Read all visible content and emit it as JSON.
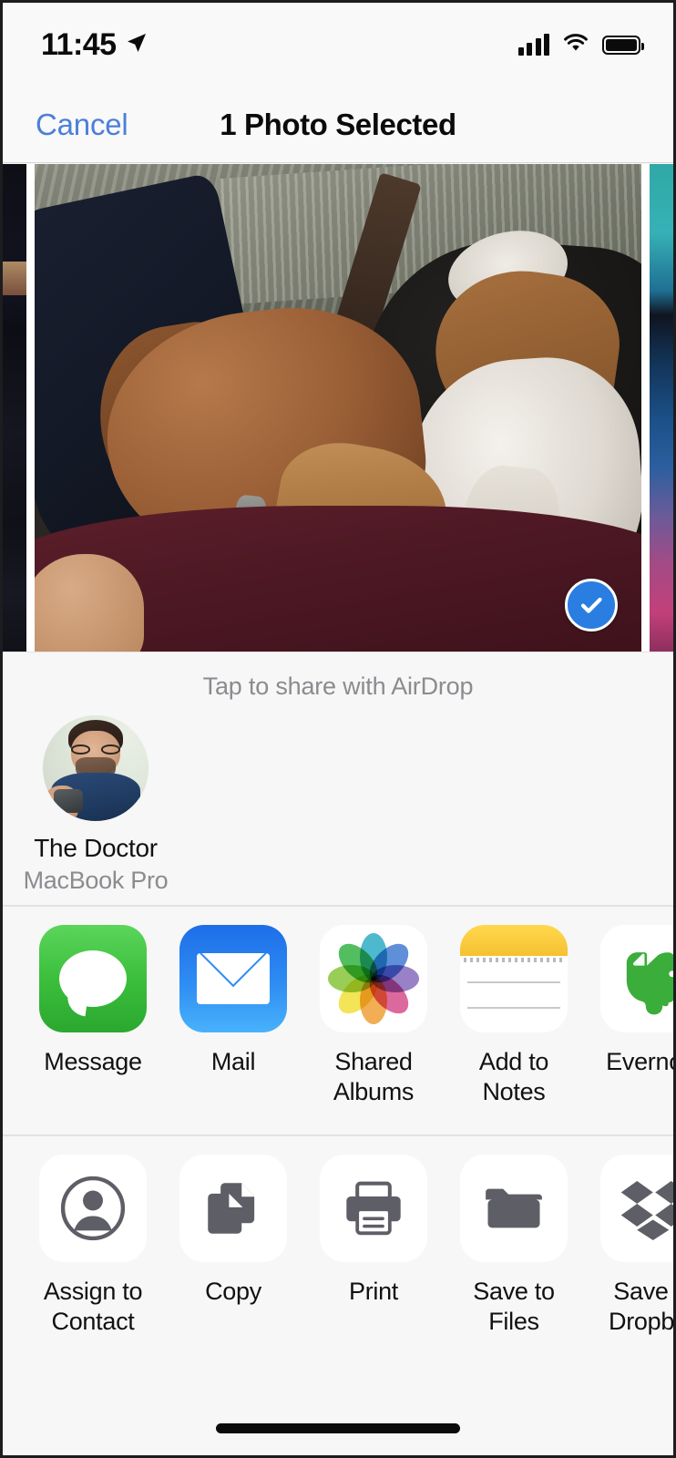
{
  "status_bar": {
    "time": "11:45",
    "location_icon": "location-arrow-icon",
    "cellular_icon": "signal-bars-icon",
    "wifi_icon": "wifi-icon",
    "battery_icon": "battery-full-icon"
  },
  "nav": {
    "cancel_label": "Cancel",
    "title": "1 Photo Selected"
  },
  "photo_strip": {
    "selected_badge_icon": "checkmark-circle-icon",
    "selected_count": 1,
    "previous_thumb_label": "previous-photo",
    "current_thumb_label": "selected-photo-dog",
    "next_thumb_label": "next-photo"
  },
  "airdrop": {
    "hint": "Tap to share with AirDrop",
    "contacts": [
      {
        "name": "The Doctor",
        "device": "MacBook Pro",
        "avatar_icon": "contact-avatar"
      }
    ]
  },
  "app_row": {
    "items": [
      {
        "label": "Message",
        "icon": "messages-icon"
      },
      {
        "label": "Mail",
        "icon": "mail-icon"
      },
      {
        "label": "Shared\nAlbums",
        "icon": "photos-icon"
      },
      {
        "label": "Add to Notes",
        "icon": "notes-icon"
      },
      {
        "label": "Evernote",
        "icon": "evernote-icon"
      }
    ]
  },
  "action_row": {
    "items": [
      {
        "label": "Assign\nto Contact",
        "icon": "assign-to-contact-icon"
      },
      {
        "label": "Copy",
        "icon": "copy-icon"
      },
      {
        "label": "Print",
        "icon": "print-icon"
      },
      {
        "label": "Save to Files",
        "icon": "folder-icon"
      },
      {
        "label": "Save to\nDropbox",
        "icon": "dropbox-icon"
      }
    ]
  },
  "home_indicator": {
    "label": "home-indicator"
  },
  "colors": {
    "accent_blue": "#4c7fd9",
    "check_blue": "#2a7de1",
    "background": "#f7f7f7",
    "bar_background": "#f9f9f9",
    "primary_text": "#111114",
    "secondary_text": "#8b8b90",
    "glyph_gray": "#5e5e66",
    "separator": "#e2e2e2",
    "messages_green": "#3cbf3c",
    "mail_blue": "#2f8df3",
    "notes_yellow": "#f5c132",
    "evernote_green": "#3aad3a"
  },
  "photos_pinwheel_colors": [
    "#f0a33c",
    "#f3e13f",
    "#8cc63f",
    "#3bb54a",
    "#35b0c8",
    "#4a7fd4",
    "#8a6fc0",
    "#d8548f"
  ]
}
